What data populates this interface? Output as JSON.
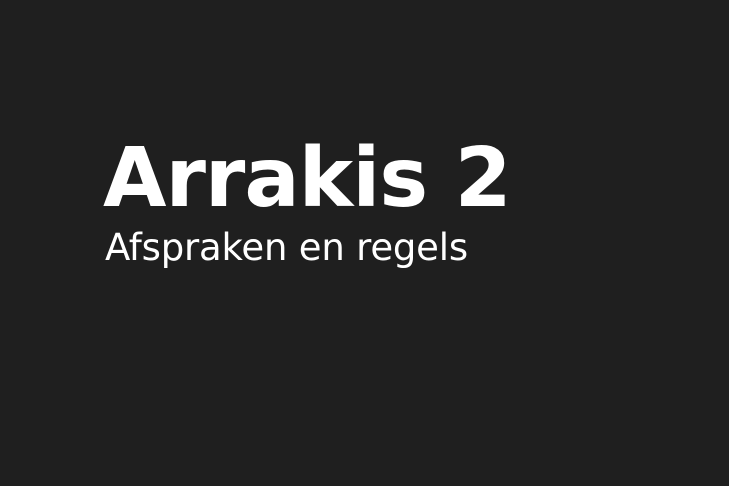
{
  "title": "Arrakis 2",
  "subtitle": "Afspraken en regels",
  "colors": {
    "background": "#1f1f1f",
    "text": "#ffffff"
  }
}
